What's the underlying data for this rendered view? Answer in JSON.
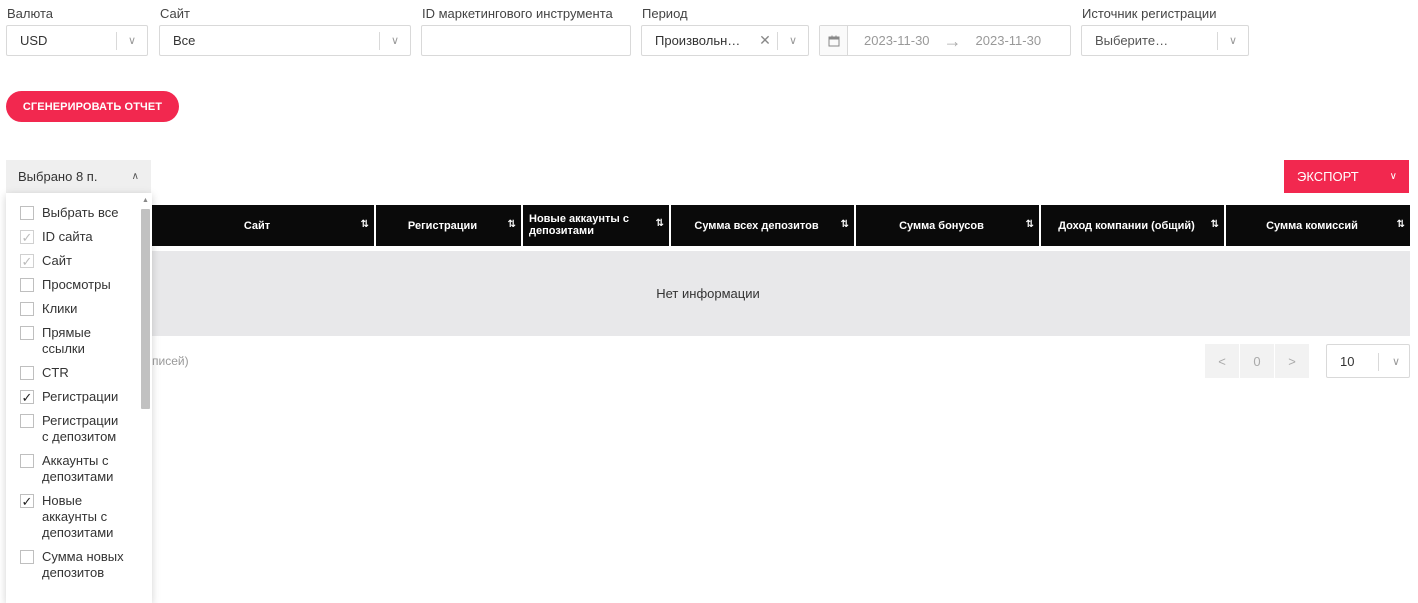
{
  "filters": {
    "currency": {
      "label": "Валюта",
      "value": "USD"
    },
    "site": {
      "label": "Сайт",
      "value": "Все"
    },
    "marketing_id": {
      "label": "ID маркетингового инструмента",
      "value": ""
    },
    "period": {
      "label": "Период",
      "value": "Произвольн…"
    },
    "date_from": "2023-11-30",
    "date_to": "2023-11-30",
    "reg_source": {
      "label": "Источник регистрации",
      "placeholder": "Выберите…"
    }
  },
  "generate_button": "СГЕНЕРИРОВАТЬ ОТЧЕТ",
  "columns_toggle": "Выбрано 8 п.",
  "export_button": "ЭКСПОРТ",
  "table": {
    "headers": [
      "Сайт",
      "Регистрации",
      "Новые аккаунты с депозитами",
      "Сумма всех депозитов",
      "Сумма бонусов",
      "Доход компании (общий)",
      "Сумма комиссий"
    ],
    "empty_text": "Нет информации",
    "records_text": "писей)"
  },
  "pagination": {
    "current": "0",
    "per_page": "10"
  },
  "column_menu": [
    {
      "label": "Выбрать все",
      "checked": false,
      "disabled": false
    },
    {
      "label": "ID сайта",
      "checked": true,
      "disabled": true
    },
    {
      "label": "Сайт",
      "checked": true,
      "disabled": true
    },
    {
      "label": "Просмотры",
      "checked": false,
      "disabled": false
    },
    {
      "label": "Клики",
      "checked": false,
      "disabled": false
    },
    {
      "label": "Прямые ссылки",
      "checked": false,
      "disabled": false
    },
    {
      "label": "CTR",
      "checked": false,
      "disabled": false
    },
    {
      "label": "Регистрации",
      "checked": true,
      "disabled": false
    },
    {
      "label": "Регистрации с депозитом",
      "checked": false,
      "disabled": false
    },
    {
      "label": "Аккаунты с депозитами",
      "checked": false,
      "disabled": false
    },
    {
      "label": "Новые аккаунты с депозитами",
      "checked": true,
      "disabled": false
    },
    {
      "label": "Сумма новых депозитов",
      "checked": false,
      "disabled": false
    }
  ]
}
